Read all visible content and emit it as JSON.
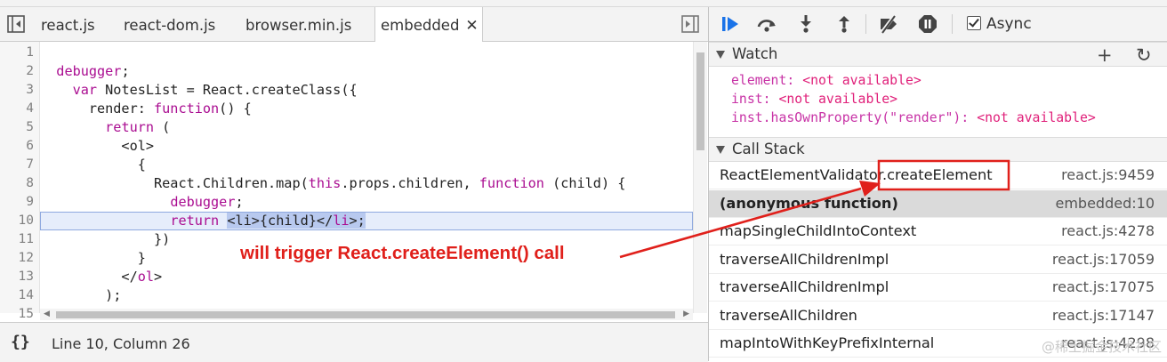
{
  "tabs": [
    {
      "label": "react.js",
      "active": false
    },
    {
      "label": "react-dom.js",
      "active": false
    },
    {
      "label": "browser.min.js",
      "active": false
    },
    {
      "label": "embedded",
      "active": true
    }
  ],
  "editor": {
    "line_numbers": [
      "1",
      "2",
      "3",
      "4",
      "5",
      "6",
      "7",
      "8",
      "9",
      "10",
      "11",
      "12",
      "13",
      "14",
      "15"
    ],
    "execution_line": 10
  },
  "status": {
    "format_button": "{}",
    "cursor_position": "Line 10, Column 26"
  },
  "annotation": {
    "text": "will trigger React.createElement() call",
    "color": "#e0201b"
  },
  "debugger": {
    "async_label": "Async",
    "async_checked": true,
    "toolbar": [
      "resume-icon",
      "step-over-icon",
      "step-into-icon",
      "step-out-icon",
      "deactivate-breakpoints-icon",
      "pause-on-exceptions-icon"
    ]
  },
  "watch": {
    "title": "Watch",
    "add_button": "+",
    "refresh_button": "↻",
    "items": [
      {
        "expr": "element",
        "value": "<not available>"
      },
      {
        "expr": "inst",
        "value": "<not available>"
      },
      {
        "expr": "inst.hasOwnProperty(\"render\")",
        "value": "<not available>"
      }
    ]
  },
  "call_stack": {
    "title": "Call Stack",
    "frames": [
      {
        "name": "ReactElementValidator.createElement",
        "location": "react.js:9459",
        "selected": false
      },
      {
        "name": "(anonymous function)",
        "location": "embedded:10",
        "selected": true
      },
      {
        "name": "mapSingleChildIntoContext",
        "location": "react.js:4278",
        "selected": false
      },
      {
        "name": "traverseAllChildrenImpl",
        "location": "react.js:17059",
        "selected": false
      },
      {
        "name": "traverseAllChildrenImpl",
        "location": "react.js:17075",
        "selected": false
      },
      {
        "name": "traverseAllChildren",
        "location": "react.js:17147",
        "selected": false
      },
      {
        "name": "mapIntoWithKeyPrefixInternal",
        "location": "react.js:4298",
        "selected": false
      }
    ]
  },
  "watermark": "@稀土掘金技术社区"
}
